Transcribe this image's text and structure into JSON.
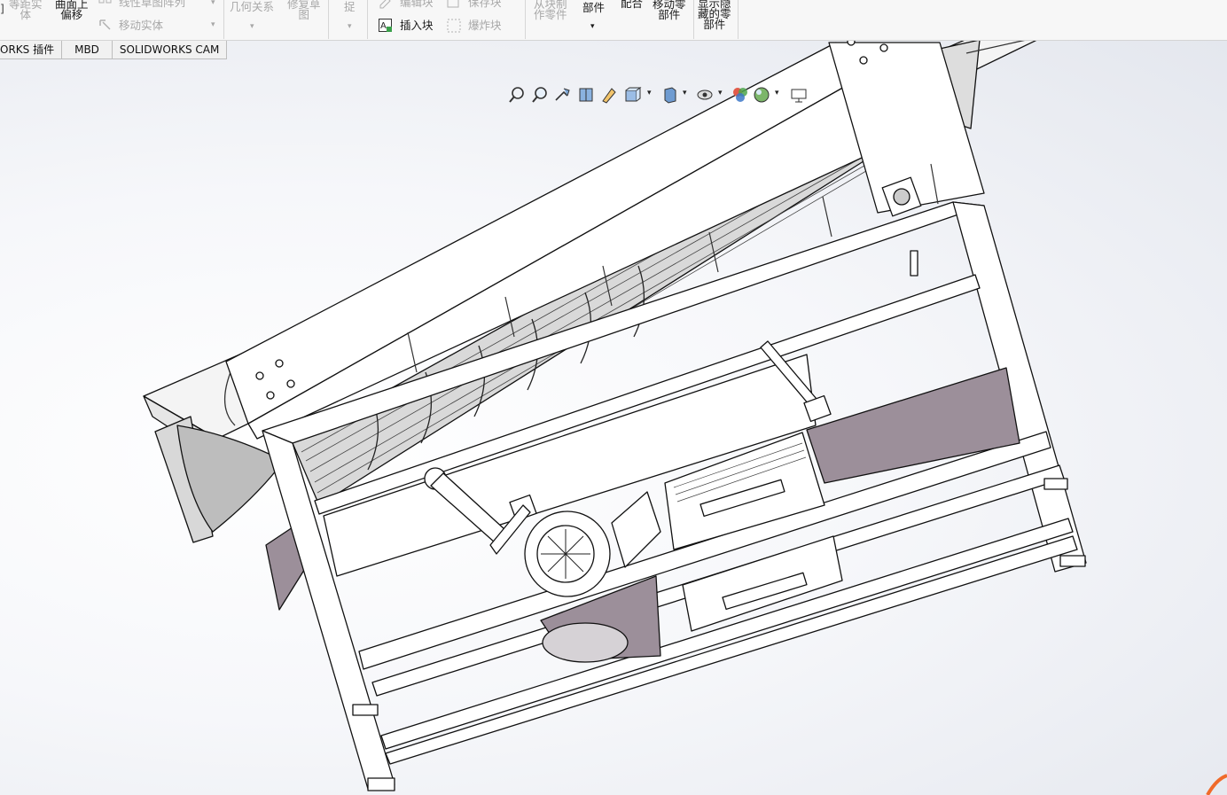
{
  "ribbon": {
    "g1": {
      "l1": "等距实",
      "l2": "体"
    },
    "g2": {
      "l1": "曲面上",
      "l2": "偏移"
    },
    "linear_pattern": "线性草图阵列",
    "move_entities": "移动实体",
    "relations": "几何关系",
    "repair": {
      "l1": "修复草",
      "l2": "图"
    },
    "quick_snaps": "捉",
    "edit_block": "编辑块",
    "insert_block": "插入块",
    "save_block": "保存块",
    "explode_block": "爆炸块",
    "from_part": {
      "l1": "从块制",
      "l2": "作零件"
    },
    "part": "部件",
    "mate": "配合",
    "move_component": {
      "l1": "移动零",
      "l2": "部件"
    },
    "show_hidden": {
      "l1": "显示隐",
      "l2": "藏的零",
      "l3": "部件"
    }
  },
  "tabs": [
    {
      "label": "ORKS 插件"
    },
    {
      "label": "MBD"
    },
    {
      "label": "SOLIDWORKS CAM"
    }
  ],
  "heads_up_toolbar": [
    {
      "icon": "zoom-to-fit-icon"
    },
    {
      "icon": "zoom-to-area-icon"
    },
    {
      "icon": "previous-view-icon"
    },
    {
      "icon": "section-view-icon"
    },
    {
      "icon": "dynamic-annotation-icon"
    },
    {
      "icon": "view-orientation-icon"
    },
    {
      "icon": "display-style-icon"
    },
    {
      "icon": "hide-show-items-icon"
    },
    {
      "icon": "edit-appearance-icon"
    },
    {
      "icon": "apply-scene-icon"
    },
    {
      "icon": "view-settings-icon"
    }
  ],
  "colors": {
    "model_fill": "#ffffff",
    "model_shadow": "#9c8f9a",
    "edge": "#111111",
    "viewport_edge": "#e4e7ee",
    "accent": "#f06a2a"
  }
}
